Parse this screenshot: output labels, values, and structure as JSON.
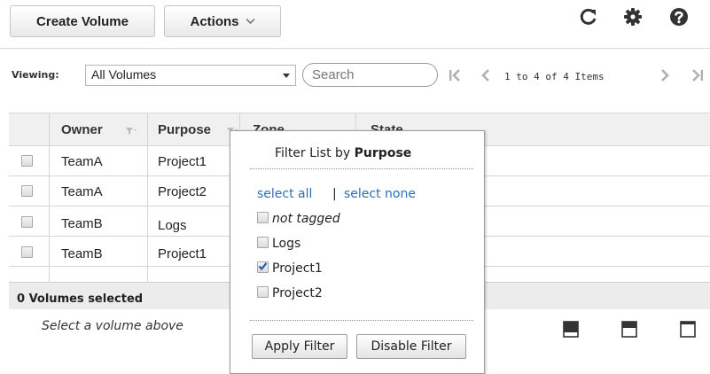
{
  "toolbar": {
    "create_label": "Create Volume",
    "actions_label": "Actions",
    "refresh_icon": "refresh-icon",
    "settings_icon": "gear-icon",
    "help_icon": "help-icon"
  },
  "viewing": {
    "label": "Viewing:",
    "selected": "All Volumes",
    "search_placeholder": "Search",
    "pager_text": "1 to 4 of 4 Items"
  },
  "table": {
    "columns": [
      "Owner",
      "Purpose",
      "Zone",
      "State"
    ],
    "rows": [
      {
        "owner": "TeamA",
        "purpose": "Project1"
      },
      {
        "owner": "TeamA",
        "purpose": "Project2"
      },
      {
        "owner": "TeamB",
        "purpose": "Logs"
      },
      {
        "owner": "TeamB",
        "purpose": "Project1"
      }
    ]
  },
  "footer": {
    "selected_text": "0 Volumes selected",
    "hint": "Select a volume above"
  },
  "filter_popup": {
    "title_prefix": "Filter List by",
    "title_field": "Purpose",
    "select_all": "select all",
    "separator": "|",
    "select_none": "select none",
    "options": [
      {
        "label": "not tagged",
        "checked": false,
        "italic": true
      },
      {
        "label": "Logs",
        "checked": false,
        "italic": false
      },
      {
        "label": "Project1",
        "checked": true,
        "italic": false
      },
      {
        "label": "Project2",
        "checked": false,
        "italic": false
      }
    ],
    "apply_label": "Apply Filter",
    "disable_label": "Disable Filter"
  },
  "colors": {
    "link": "#2a6fb8",
    "header_bg": "#f0f0f0",
    "check": "#1f5fa8"
  }
}
